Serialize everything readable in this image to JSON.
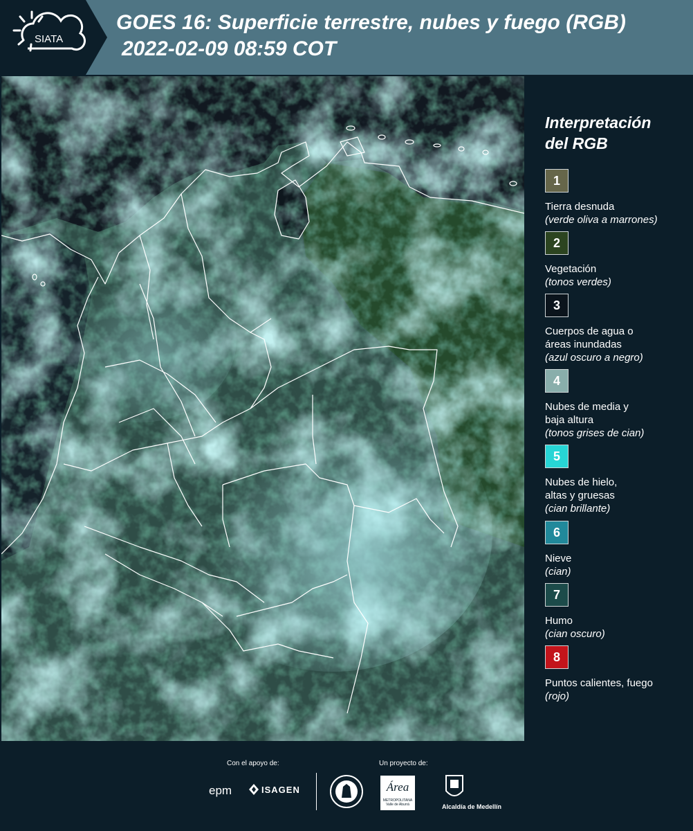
{
  "header": {
    "logo_text": "SIATA",
    "title_line1": "GOES 16: Superficie terrestre, nubes y fuego (RGB)",
    "title_line2": "2022-02-09 08:59 COT",
    "bg_color": "#4f7584"
  },
  "map": {
    "alt": "Imagen satelital RGB de Colombia"
  },
  "legend": {
    "title_line1": "Interpretación",
    "title_line2": "del RGB",
    "items": [
      {
        "num": "1",
        "color": "#66664a",
        "label": "Tierra desnuda",
        "hint": "(verde oliva a marrones)"
      },
      {
        "num": "2",
        "color": "#2c4420",
        "label": "Vegetación",
        "hint": "(tonos verdes)"
      },
      {
        "num": "3",
        "color": "#0b141c",
        "label": "Cuerpos de agua o",
        "label2": "áreas inundadas",
        "hint": "(azul oscuro a negro)"
      },
      {
        "num": "4",
        "color": "#89aeab",
        "label": "Nubes de media y",
        "label2": "baja altura",
        "hint": "(tonos grises de cian)"
      },
      {
        "num": "5",
        "color": "#27d5d5",
        "label": "Nubes de hielo,",
        "label2": "altas y gruesas",
        "hint": "(cian brillante)"
      },
      {
        "num": "6",
        "color": "#21899b",
        "label": "Nieve",
        "hint": "(cian)"
      },
      {
        "num": "7",
        "color": "#1c4b4a",
        "label": "Humo",
        "hint": "(cian oscuro)"
      },
      {
        "num": "8",
        "color": "#c3141b",
        "label": "Puntos calientes, fuego",
        "hint": "(rojo)"
      }
    ]
  },
  "footer": {
    "support_label": "Con el apoyo de:",
    "project_label": "Un proyecto de:",
    "sponsors": [
      "epm",
      "ISAGEN"
    ],
    "partners": [
      "METROPOLITANA",
      "Valle de Aburrá",
      "Alcaldía de Medellín"
    ],
    "area_text": "Área"
  }
}
